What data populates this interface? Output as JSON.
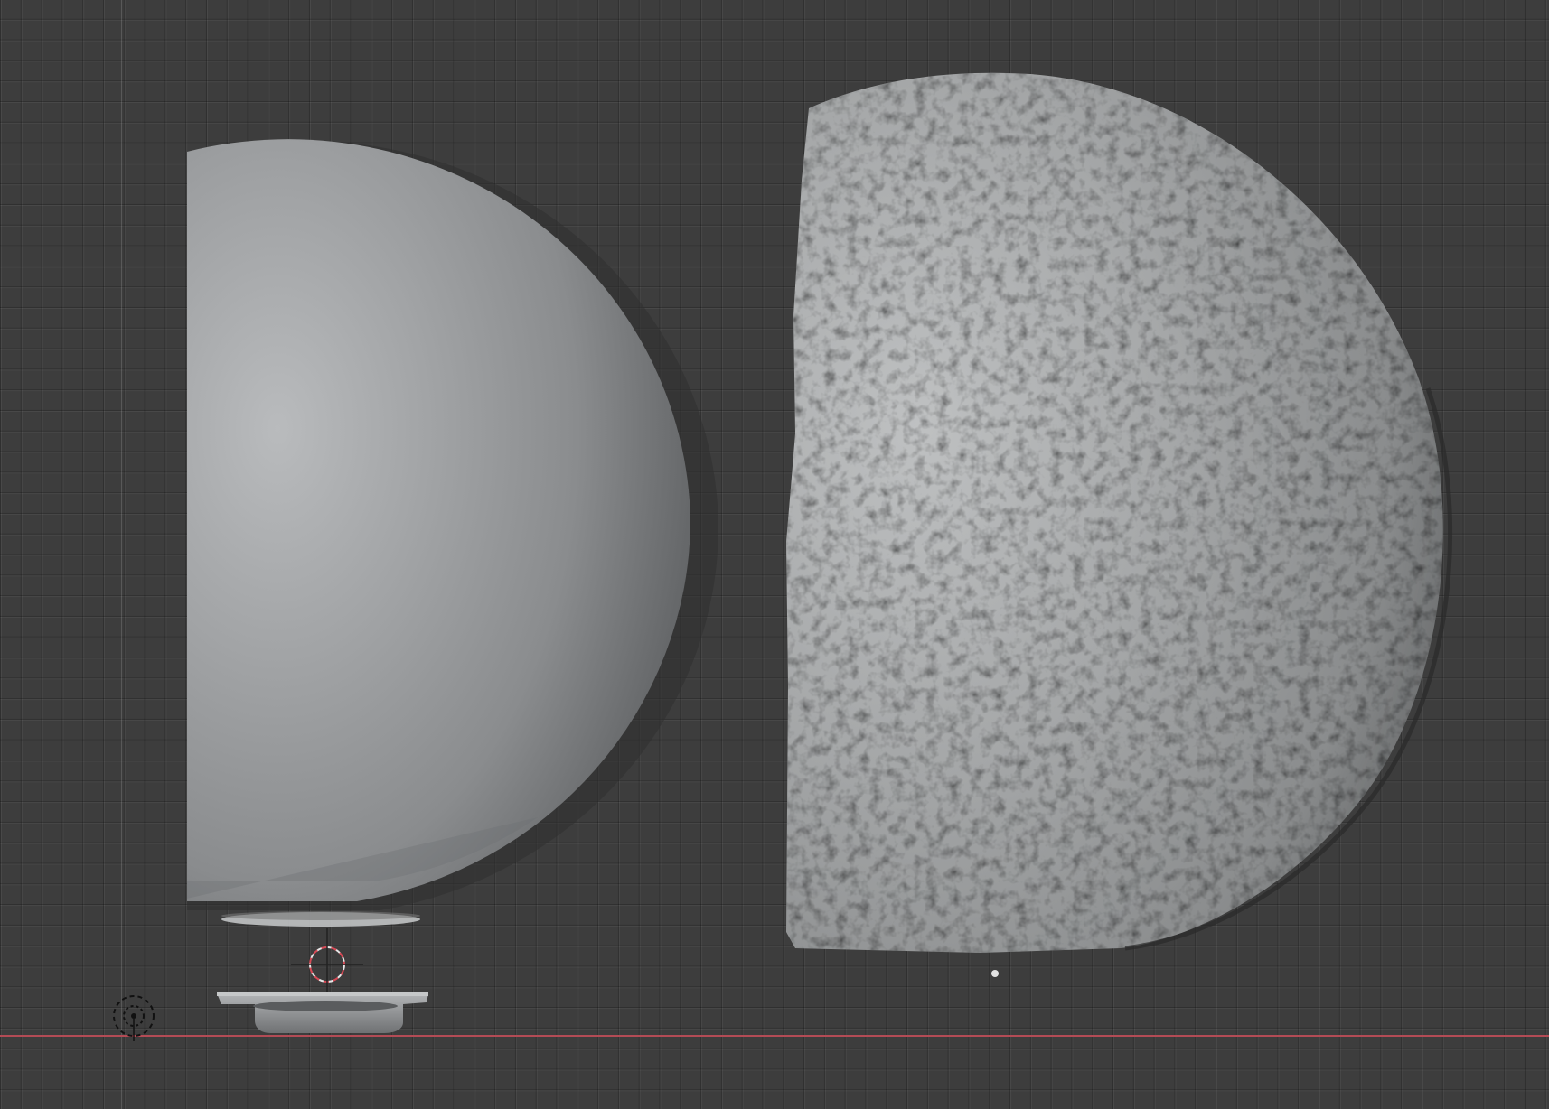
{
  "viewport": {
    "view": "orthographic-side",
    "background_color": "#3d3d3d",
    "grid_line_color": "#353535",
    "x_axis_color": "#b34b55"
  },
  "objects": [
    {
      "name": "smooth-half-sphere",
      "shading": "solid",
      "color": "#9a9c9e"
    },
    {
      "name": "textured-half-sphere",
      "shading": "solid",
      "color": "#a3a5a6"
    },
    {
      "name": "base-plate",
      "shading": "solid",
      "color": "#8e9092"
    }
  ],
  "overlays": {
    "cursor_3d_icon": "3d-cursor-icon",
    "light_icon": "light-gizmo-icon",
    "object_origin_icon": "origin-dot-icon"
  }
}
